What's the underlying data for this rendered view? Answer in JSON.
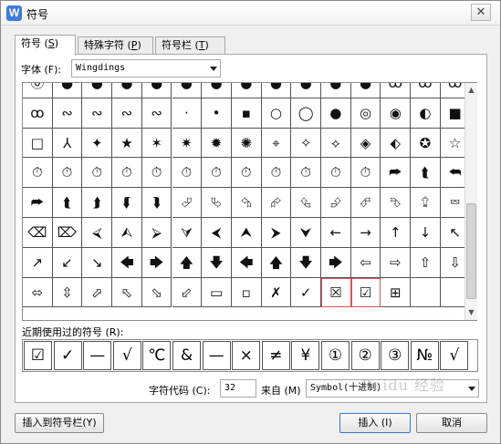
{
  "window": {
    "title": "符号",
    "app_icon": "W",
    "close_glyph": "✕"
  },
  "tabs": [
    {
      "label": "符号(S)",
      "html": "符号 (<u>S</u>)"
    },
    {
      "label": "特殊字符(P)",
      "html": "特殊字符 (<u>P</u>)"
    },
    {
      "label": "符号栏(T)",
      "html": "符号栏 (<u>T</u>)"
    }
  ],
  "font": {
    "label": "字体 (F):",
    "value": "Wingdings"
  },
  "symbol_rows": [
    [
      "⓪",
      "●",
      "●",
      "●",
      "●",
      "●",
      "●",
      "●",
      "●",
      "●",
      "●",
      "●",
      "ꝏ",
      "ꝏ",
      "ꝏ"
    ],
    [
      "ꝏ",
      "∾",
      "∾",
      "∾",
      "∾",
      "·",
      "•",
      "▪",
      "○",
      "◯",
      "●",
      "◎",
      "◉",
      "◐",
      "■"
    ],
    [
      "□",
      "⅄",
      "✦",
      "★",
      "✶",
      "✷",
      "✹",
      "✺",
      "⌖",
      "✧",
      "⟡",
      "◈",
      "⬖",
      "✪",
      "☆"
    ],
    [
      "⏱",
      "⏱",
      "⏱",
      "⏱",
      "⏱",
      "⏱",
      "⏱",
      "⏱",
      "⏱",
      "⏱",
      "⏱",
      "⏱",
      "⮫",
      "⮬",
      "⮪"
    ],
    [
      "⮫",
      "⮬",
      "⮭",
      "⮮",
      "⮯",
      "⮰",
      "⮱",
      "⮲",
      "⮳",
      "⮴",
      "⮵",
      "⮶",
      "⮷",
      "⮸",
      "⮹"
    ],
    [
      "⌫",
      "⌦",
      "⮘",
      "⮙",
      "⮚",
      "⮛",
      "⮜",
      "⮝",
      "⮞",
      "⮟",
      "←",
      "→",
      "↑",
      "↓",
      "↖"
    ],
    [
      "↗",
      "↙",
      "↘",
      "🡄",
      "🡆",
      "🡅",
      "🡇",
      "🡄",
      "🡅",
      "🡇",
      "🡆",
      "⇦",
      "⇨",
      "⇧",
      "⇩"
    ],
    [
      "⬄",
      "⇳",
      "⬀",
      "⬁",
      "⬂",
      "⬃",
      "▭",
      "▫",
      "✗",
      "✓",
      "☒",
      "☑",
      "⊞",
      "",
      ""
    ]
  ],
  "selected_symbols": [
    {
      "row": 7,
      "col": 10
    },
    {
      "row": 7,
      "col": 11
    }
  ],
  "recent": {
    "label": "近期使用过的符号 (R):",
    "symbols": [
      "☑",
      "✓",
      "—",
      "√",
      "℃",
      "&",
      "—",
      "×",
      "≠",
      "¥",
      "①",
      "②",
      "③",
      "№",
      "√"
    ]
  },
  "code": {
    "label": "字符代码 (C):",
    "value": "32"
  },
  "from": {
    "label": "来自 (M)",
    "value": "Symbol(十进制)"
  },
  "buttons": {
    "insert_to_bar": "插入到符号栏(Y)",
    "insert": "插入 (I)",
    "cancel": "取消"
  },
  "watermark": "Baidu 经验"
}
